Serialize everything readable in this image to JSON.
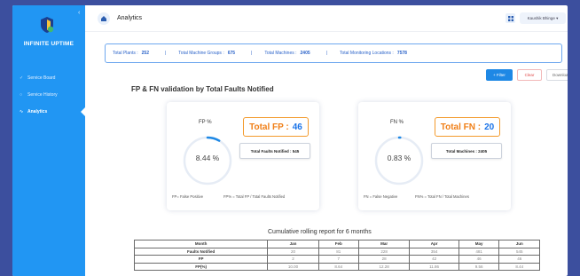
{
  "sidebar": {
    "brand": "INFINITE UPTIME",
    "collapse_icon": "chevron-left-icon",
    "items": [
      {
        "label": "Service Board",
        "icon": "check-icon"
      },
      {
        "label": "Service History",
        "icon": "circle-icon"
      },
      {
        "label": "Analytics",
        "icon": "chart-icon",
        "active": true
      }
    ]
  },
  "header": {
    "title": "Analytics",
    "home_icon": "home-icon",
    "apps_icon": "grid-icon",
    "user": "Kaushik Bhinge ▾"
  },
  "summary": {
    "items": [
      {
        "label": "Total Plants :",
        "value": "252"
      },
      {
        "label": "Total Machine Groups :",
        "value": "675"
      },
      {
        "label": "Total Machines :",
        "value": "2405"
      },
      {
        "label": "Total Monitoring Locations :",
        "value": "7578"
      }
    ],
    "separator": "|"
  },
  "actions": {
    "filter": "+ Filter",
    "clear": "Clear",
    "download": "Download"
  },
  "section_title": "FP & FN validation by Total Faults Notified",
  "fp_card": {
    "label": "FP %",
    "percent": "8.44 %",
    "percent_value": 8.44,
    "total_prefix": "Total FP :",
    "total_value": "46",
    "stat": "Total Faults Notified : 545",
    "legend_left": "FP= False Positive",
    "legend_right": "FP% = Total FP / Total Faults Notified"
  },
  "fn_card": {
    "label": "FN %",
    "percent": "0.83 %",
    "percent_value": 0.83,
    "total_prefix": "Total FN :",
    "total_value": "20",
    "stat": "Total Machines : 2405",
    "legend_left": "FN = False Negative",
    "legend_right": "FN% = Total FN / Total Machines"
  },
  "rolling": {
    "title": "Cumulative rolling report for 6 months",
    "headers": [
      "Month",
      "Jan",
      "Feb",
      "Mar",
      "Apr",
      "May",
      "Jun"
    ],
    "rows": [
      [
        "Faults Notified",
        "20",
        "81",
        "228",
        "354",
        "481",
        "545"
      ],
      [
        "FP",
        "2",
        "7",
        "28",
        "42",
        "46",
        "46"
      ],
      [
        "FP(%)",
        "10.00",
        "8.64",
        "12.28",
        "11.86",
        "9.56",
        "8.44"
      ]
    ]
  },
  "colors": {
    "sidebar": "#2196f3",
    "accent": "#1e88e5",
    "orange": "#f07f17",
    "background": "#3c4f9e"
  }
}
